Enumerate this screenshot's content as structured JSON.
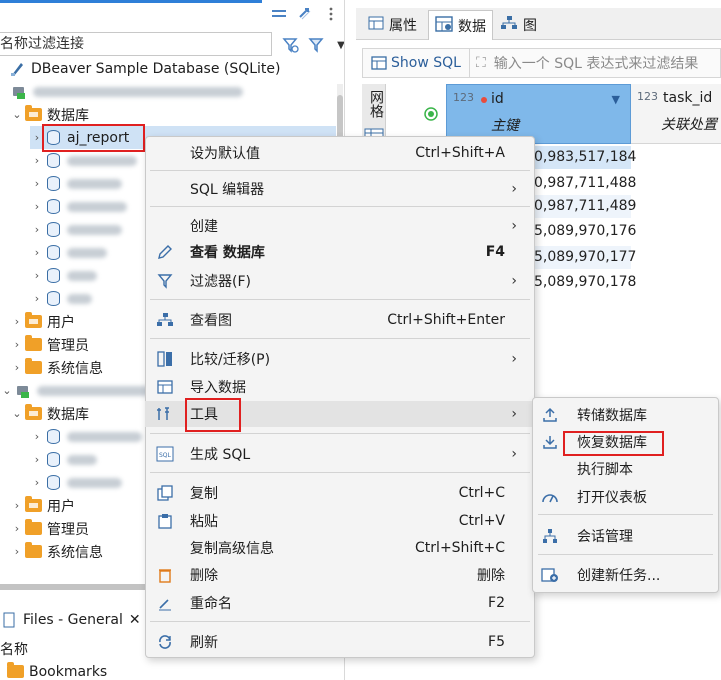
{
  "navigator": {
    "filter_placeholder": "名称过滤连接",
    "connection1_name": "DBeaver Sample Database (SQLite)",
    "tree": {
      "databases1": "数据库",
      "aj_report": "aj_report",
      "users1": "用户",
      "admins1": "管理员",
      "sysinfo1": "系统信息",
      "databases2": "数据库",
      "users2": "用户",
      "admins2": "管理员",
      "sysinfo2": "系统信息"
    },
    "files_tab": "Files - General",
    "files_close": "✕",
    "files_col_name": "名称",
    "bookmarks": "Bookmarks"
  },
  "editor": {
    "tabs": {
      "properties": "属性",
      "data": "数据",
      "diagram": "图"
    },
    "show_sql": "Show SQL",
    "sql_filter_placeholder": "输入一个 SQL 表达式来过滤结果",
    "grid_side_label": "网格",
    "columns": [
      {
        "type": "123",
        "name": "id",
        "sub": "主键"
      },
      {
        "type": "123",
        "name": "task_id",
        "sub": "关联处置"
      }
    ],
    "rows": [
      "0,983,517,184",
      "0,987,711,488",
      "0,987,711,489",
      "5,089,970,176",
      "5,089,970,177",
      "5,089,970,178"
    ]
  },
  "context_menu": {
    "set_default": {
      "label": "设为默认值",
      "key": "Ctrl+Shift+A"
    },
    "sql_editor": {
      "label": "SQL 编辑器"
    },
    "create": {
      "label": "创建"
    },
    "view_db": {
      "label": "查看 数据库",
      "key": "F4"
    },
    "filter": {
      "label": "过滤器(F)"
    },
    "view_diagram": {
      "label": "查看图",
      "key": "Ctrl+Shift+Enter"
    },
    "compare": {
      "label": "比较/迁移(P)"
    },
    "import": {
      "label": "导入数据"
    },
    "tools": {
      "label": "工具"
    },
    "gen_sql": {
      "label": "生成 SQL"
    },
    "copy": {
      "label": "复制",
      "key": "Ctrl+C"
    },
    "paste": {
      "label": "粘贴",
      "key": "Ctrl+V"
    },
    "copy_adv": {
      "label": "复制高级信息",
      "key": "Ctrl+Shift+C"
    },
    "delete": {
      "label": "删除",
      "key": "删除"
    },
    "rename": {
      "label": "重命名",
      "key": "F2"
    },
    "refresh": {
      "label": "刷新",
      "key": "F5"
    }
  },
  "tools_submenu": {
    "dump": "转储数据库",
    "restore": "恢复数据库",
    "exec_script": "执行脚本",
    "dashboard": "打开仪表板",
    "session_mgr": "会话管理",
    "new_task": "创建新任务..."
  },
  "colors": {
    "accent": "#2f7fd8",
    "folder": "#f0a028",
    "highlight_red": "#e02020",
    "column_header_selected": "#7fb8ea"
  }
}
